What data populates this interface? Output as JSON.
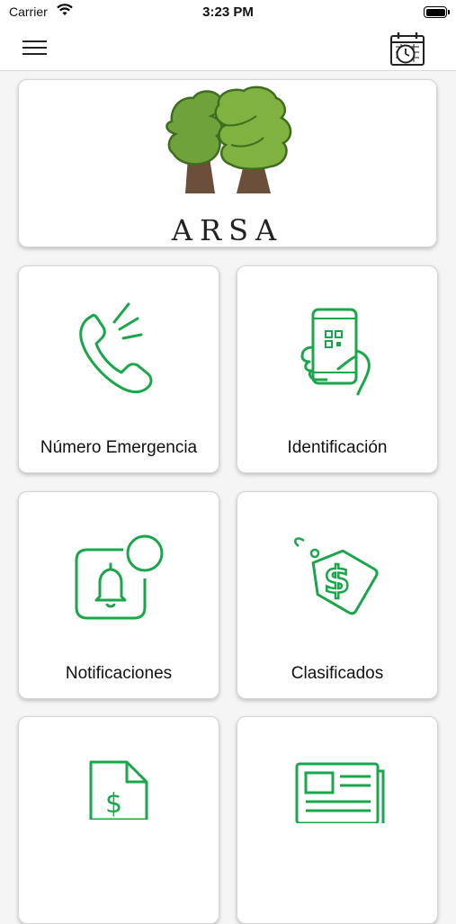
{
  "status_bar": {
    "carrier": "Carrier",
    "time": "3:23 PM"
  },
  "header": {
    "menu_icon": "hamburger-menu-icon",
    "calendar_icon": "calendar-clock-icon"
  },
  "logo": {
    "text": "ARSA",
    "icon": "trees-logo"
  },
  "accent_color": "#1aa64a",
  "tiles": [
    {
      "label": "Número Emergencia",
      "icon": "phone-icon"
    },
    {
      "label": "Identificación",
      "icon": "phone-qr-icon"
    },
    {
      "label": "Notificaciones",
      "icon": "bell-notification-icon"
    },
    {
      "label": "Clasificados",
      "icon": "price-tag-icon"
    },
    {
      "label": "",
      "icon": "dollar-document-icon"
    },
    {
      "label": "",
      "icon": "newspaper-icon"
    }
  ]
}
